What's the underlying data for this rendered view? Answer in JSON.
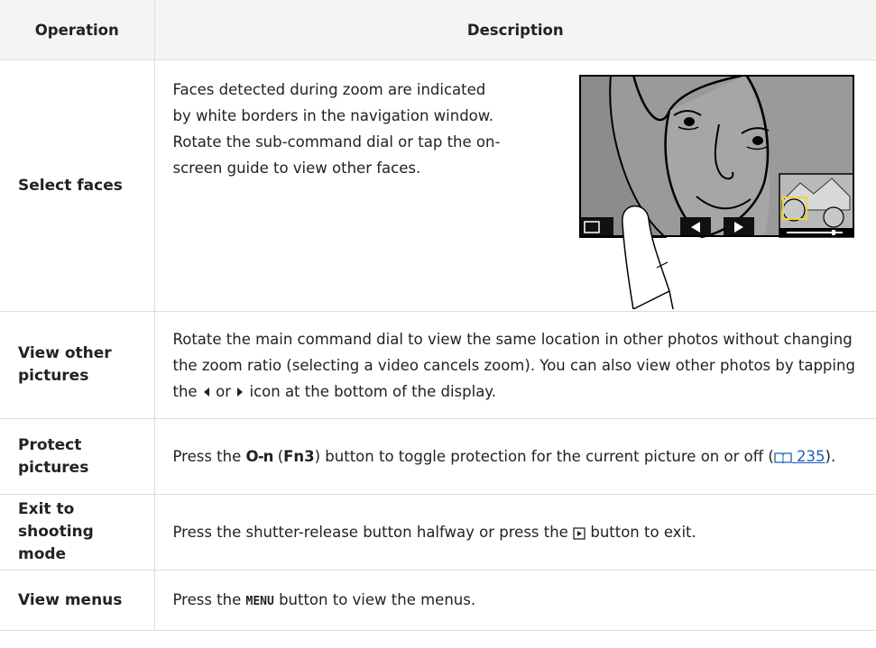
{
  "table": {
    "headers": [
      "Operation",
      "Description"
    ],
    "rows": [
      {
        "operation": "Select faces",
        "description": "Faces detected during zoom are indicated by white borders in the navigation window. Rotate the sub-command dial or tap the on-screen guide to view other faces."
      },
      {
        "operation_line1": "View other",
        "operation_line2": "pictures",
        "description_a": "Rotate the main command dial to view the same location in other photos without changing the zoom ratio (selecting a video cancels zoom). You can also view other photos by tapping the",
        "description_b": "or",
        "description_c": "icon at the bottom of the display."
      },
      {
        "operation_line1": "Protect",
        "operation_line2": "pictures",
        "description_a": "Press the",
        "key_icon": "O-n",
        "description_b": "(",
        "fn_label": "Fn3",
        "description_c": ") button to toggle protection for the current picture on or off (",
        "page_ref": "235",
        "description_d": ")."
      },
      {
        "operation_line1": "Exit to",
        "operation_line2": "shooting mode",
        "description_a": "Press the shutter-release button halfway or press the",
        "description_b": "button to exit."
      },
      {
        "operation": "View menus",
        "description_a": "Press the",
        "menu_label": "MENU",
        "description_b": "button to view the menus."
      }
    ]
  },
  "icons": {
    "left_arrow": "left-triangle-icon",
    "right_arrow": "right-triangle-icon",
    "playback": "playback-icon",
    "book": "book-icon"
  },
  "colors": {
    "header_bg": "#f4f4f4",
    "border": "#dcdcdc",
    "link": "#1a5fb4",
    "face_border": "#f2d33a"
  }
}
